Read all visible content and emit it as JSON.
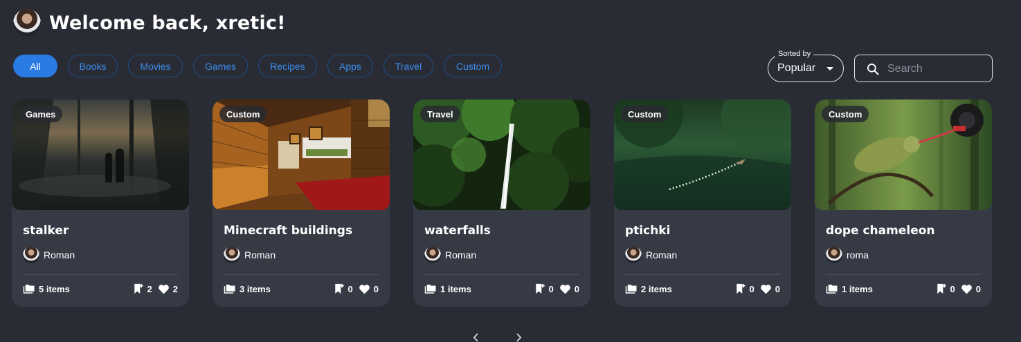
{
  "header": {
    "welcome": "Welcome back, xretic!"
  },
  "filters": [
    "All",
    "Books",
    "Movies",
    "Games",
    "Recipes",
    "Apps",
    "Travel",
    "Custom"
  ],
  "sort": {
    "label": "Sorted by",
    "value": "Popular"
  },
  "search": {
    "placeholder": "Search"
  },
  "cards": [
    {
      "category": "Games",
      "title": "stalker",
      "author": "Roman",
      "items": "5 items",
      "saves": "2",
      "likes": "2"
    },
    {
      "category": "Custom",
      "title": "Minecraft buildings",
      "author": "Roman",
      "items": "3 items",
      "saves": "0",
      "likes": "0"
    },
    {
      "category": "Travel",
      "title": "waterfalls",
      "author": "Roman",
      "items": "1 items",
      "saves": "0",
      "likes": "0"
    },
    {
      "category": "Custom",
      "title": "ptichki",
      "author": "Roman",
      "items": "2 items",
      "saves": "0",
      "likes": "0"
    },
    {
      "category": "Custom",
      "title": "dope chameleon",
      "author": "roma",
      "items": "1 items",
      "saves": "0",
      "likes": "0"
    }
  ],
  "colors": {
    "background": "#292c35",
    "card": "#363a45",
    "accent": "#2a7be4"
  }
}
